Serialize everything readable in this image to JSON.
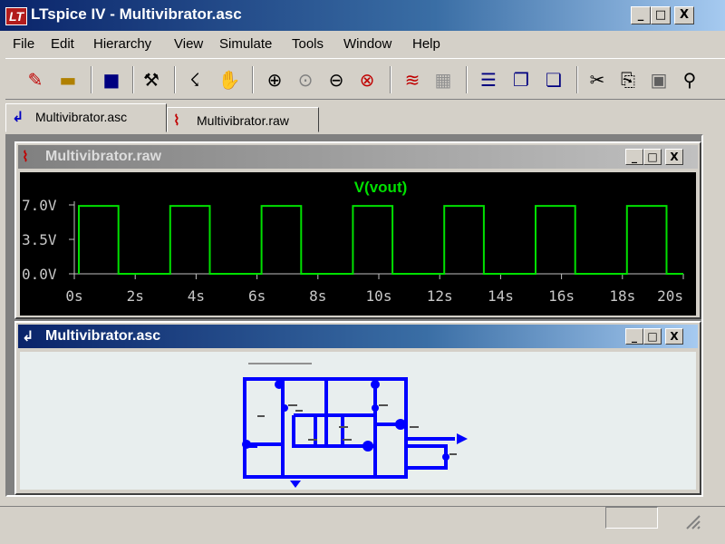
{
  "app": {
    "icon_text": "LT",
    "title": "LTspice IV - Multivibrator.asc"
  },
  "window_controls": {
    "minimize": "_",
    "maximize": "□",
    "close": "X"
  },
  "menu": [
    {
      "label": "File"
    },
    {
      "label": "Edit"
    },
    {
      "label": "Hierarchy"
    },
    {
      "label": "View"
    },
    {
      "label": "Simulate"
    },
    {
      "label": "Tools"
    },
    {
      "label": "Window"
    },
    {
      "label": "Help"
    }
  ],
  "toolbar_icons": [
    "new-schematic-icon",
    "open-icon",
    "save-icon",
    "control-panel-icon",
    "run-icon",
    "halt-icon",
    "zoom-in-icon",
    "zoom-box-icon",
    "zoom-out-icon",
    "zoom-fit-icon",
    "autorange-icon",
    "grid-icon",
    "tile-horizontal-icon",
    "cascade-icon",
    "tile-vertical-icon",
    "cut-icon",
    "copy-icon",
    "paste-icon",
    "find-icon"
  ],
  "tabs": [
    {
      "label": "Multivibrator.asc",
      "icon": "schematic-icon",
      "active": true
    },
    {
      "label": "Multivibrator.raw",
      "icon": "waveform-icon",
      "active": false
    }
  ],
  "waveform_window": {
    "title": "Multivibrator.raw",
    "trace_label": "V(vout)",
    "trace_color": "#00e000"
  },
  "schematic_window": {
    "title": "Multivibrator.asc",
    "wire_color": "#0000ff"
  },
  "chart_data": {
    "type": "line",
    "title": "V(vout)",
    "series": [
      {
        "name": "V(vout)",
        "color": "#00e000",
        "x": [
          0.15,
          0.15,
          1.45,
          1.45,
          3.15,
          3.15,
          4.45,
          4.45,
          6.15,
          6.15,
          7.45,
          7.45,
          9.15,
          9.15,
          10.45,
          10.45,
          12.15,
          12.15,
          13.45,
          13.45,
          15.15,
          15.15,
          16.45,
          16.45,
          18.15,
          18.15,
          19.45,
          19.45,
          20
        ],
        "y": [
          0,
          6.9,
          6.9,
          0,
          0,
          6.9,
          6.9,
          0,
          0,
          6.9,
          6.9,
          0,
          0,
          6.9,
          6.9,
          0,
          0,
          6.9,
          6.9,
          0,
          0,
          6.9,
          6.9,
          0,
          0,
          6.9,
          6.9,
          0,
          0
        ]
      }
    ],
    "x_ticks": [
      "0s",
      "2s",
      "4s",
      "6s",
      "8s",
      "10s",
      "12s",
      "14s",
      "16s",
      "18s",
      "20s"
    ],
    "y_ticks": [
      "0.0V",
      "3.5V",
      "7.0V"
    ],
    "xlim": [
      0,
      20
    ],
    "ylim": [
      0,
      7
    ],
    "grid": false
  }
}
